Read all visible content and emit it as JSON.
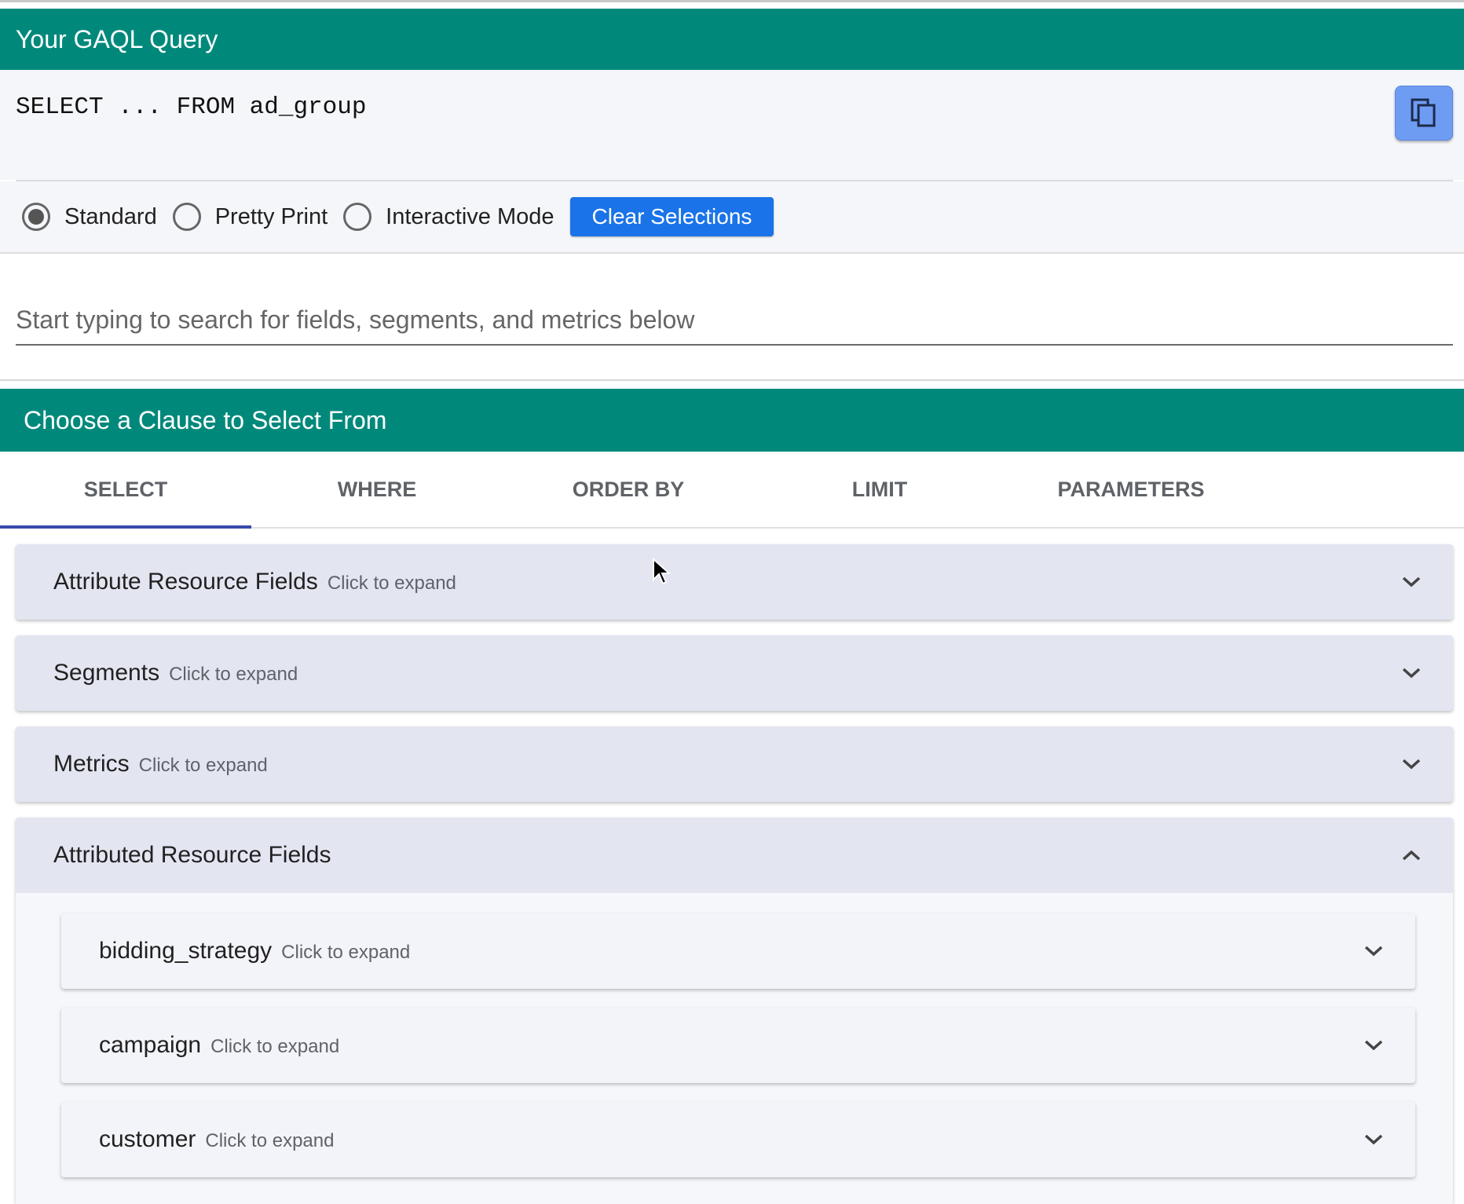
{
  "query_section": {
    "title": "Your GAQL Query",
    "query_text": "SELECT ... FROM ad_group",
    "copy_icon": "copy-icon",
    "modes": [
      {
        "label": "Standard",
        "selected": true
      },
      {
        "label": "Pretty Print",
        "selected": false
      },
      {
        "label": "Interactive Mode",
        "selected": false
      }
    ],
    "clear_label": "Clear Selections"
  },
  "search": {
    "placeholder": "Start typing to search for fields, segments, and metrics below"
  },
  "clause_section": {
    "title": "Choose a Clause to Select From",
    "tabs": [
      {
        "label": "SELECT",
        "active": true
      },
      {
        "label": "WHERE",
        "active": false
      },
      {
        "label": "ORDER BY",
        "active": false
      },
      {
        "label": "LIMIT",
        "active": false
      },
      {
        "label": "PARAMETERS",
        "active": false
      }
    ]
  },
  "panels": [
    {
      "title": "Attribute Resource Fields",
      "hint": "Click to expand"
    },
    {
      "title": "Segments",
      "hint": "Click to expand"
    },
    {
      "title": "Metrics",
      "hint": "Click to expand"
    },
    {
      "title": "Attributed Resource Fields",
      "hint": ""
    }
  ],
  "subpanels": [
    {
      "title": "bidding_strategy",
      "hint": "Click to expand"
    },
    {
      "title": "campaign",
      "hint": "Click to expand"
    },
    {
      "title": "customer",
      "hint": "Click to expand"
    }
  ],
  "colors": {
    "header": "#00897b",
    "accent_button": "#1a73e8",
    "tab_indicator": "#3949ab",
    "panel_bg": "#e3e5f1"
  }
}
